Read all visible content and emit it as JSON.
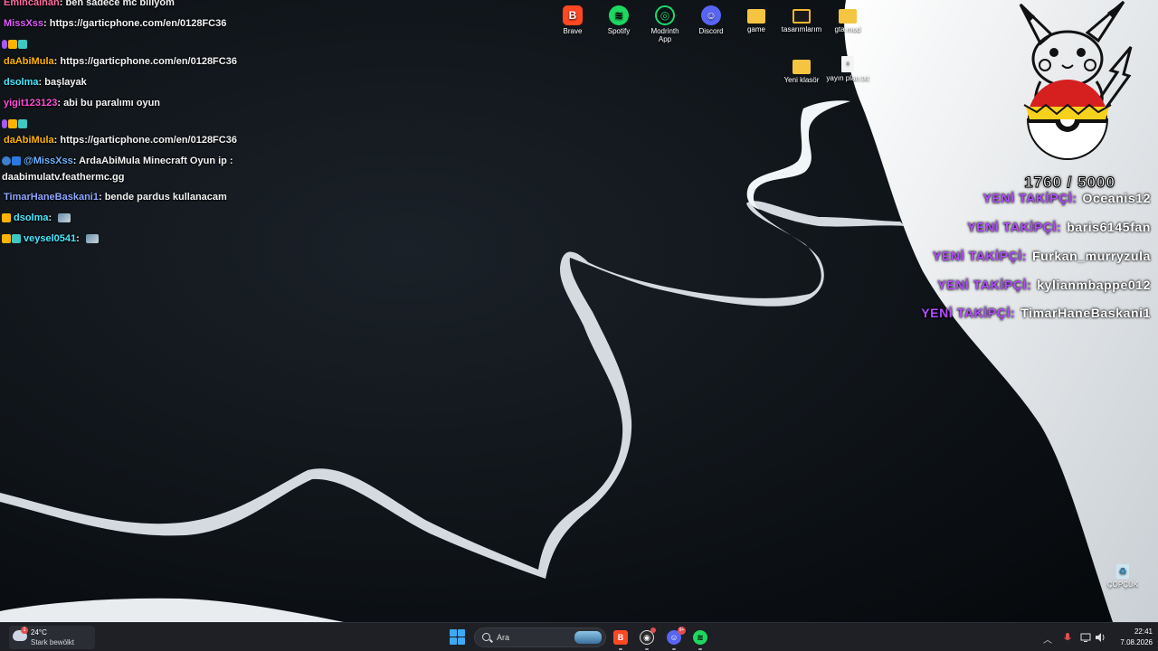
{
  "chat": {
    "messages": [
      {
        "user": "Emincalhan",
        "sep": ": ",
        "text": "ben sadece mc biliyom",
        "color": "#ff6b9d",
        "badges": [],
        "emote": false
      },
      {
        "user": "MissXss",
        "sep": ": ",
        "text": "https://garticphone.com/en/0128FC36",
        "color": "#e05cff",
        "badges": [],
        "emote": false
      },
      {
        "user": "",
        "sep": "",
        "text": "",
        "color": "#ffffff",
        "badges": [
          "mic",
          "crown",
          "gift"
        ],
        "emote": false
      },
      {
        "user": "daAbiMula",
        "sep": ": ",
        "text": "https://garticphone.com/en/0128FC36",
        "color": "#ffb300",
        "badges": [],
        "emote": false
      },
      {
        "user": "dsolma",
        "sep": ": ",
        "text": "başlayak",
        "color": "#49e8ff",
        "badges": [],
        "emote": false
      },
      {
        "user": "yigit123123",
        "sep": ": ",
        "text": "abi bu paralımı oyun",
        "color": "#ff4fd8",
        "badges": [],
        "emote": false
      },
      {
        "user": "",
        "sep": "",
        "text": "",
        "color": "#ffffff",
        "badges": [
          "mic",
          "crown",
          "gift"
        ],
        "emote": false
      },
      {
        "user": "daAbiMula",
        "sep": ": ",
        "text": "https://garticphone.com/en/0128FC36",
        "color": "#ffb300",
        "badges": [],
        "emote": false
      },
      {
        "user": "@MissXss",
        "sep": ": ",
        "text": "ArdaAbiMula Minecraft Oyun ip :",
        "color": "#6fb3ff",
        "badges": [
          "bot",
          "mod"
        ],
        "emote": false
      },
      {
        "user": "",
        "sep": "",
        "text": "daabimulatv.feathermc.gg",
        "color": "#ffffff",
        "badges": [],
        "emote": false
      },
      {
        "user": "TimarHaneBaskani1",
        "sep": ": ",
        "text": "bende pardus kullanacam",
        "color": "#8fa6ff",
        "badges": [],
        "emote": false
      },
      {
        "user": "dsolma",
        "sep": ": ",
        "text": "",
        "color": "#49e8ff",
        "badges": [
          "crown"
        ],
        "emote": true
      },
      {
        "user": "veysel0541",
        "sep": ": ",
        "text": "",
        "color": "#49e8ff",
        "badges": [
          "crown",
          "gift"
        ],
        "emote": true
      }
    ]
  },
  "desktop_icons": [
    {
      "label": "Brave",
      "icon": "brave-icon",
      "glyph": "B"
    },
    {
      "label": "Spotify",
      "icon": "spotify-icon",
      "glyph": "≋"
    },
    {
      "label": "Modrinth App",
      "icon": "modrinth-icon",
      "glyph": "◎"
    },
    {
      "label": "Discord",
      "icon": "discord-icon",
      "glyph": "☺"
    },
    {
      "label": "game",
      "icon": "folder-icon",
      "glyph": ""
    },
    {
      "label": "tasarımlarım",
      "icon": "folder-icon",
      "glyph": ""
    },
    {
      "label": "gta mod",
      "icon": "folder-icon",
      "glyph": ""
    },
    {
      "label": "Yeni klasör",
      "icon": "folder-icon",
      "glyph": ""
    },
    {
      "label": "yayın plan.txt",
      "icon": "text-file-icon",
      "glyph": "≡"
    },
    {
      "label": "ÇÖPÇÜK",
      "icon": "recycle-bin-icon",
      "glyph": "♻"
    }
  ],
  "goal": {
    "current": 1760,
    "target": 5000,
    "text": "1760 / 5000",
    "progress": 0.352
  },
  "follow_alerts": {
    "label": "YENİ TAKİPÇİ:",
    "names": [
      "Oceanis12",
      "baris6145fan",
      "Furkan_murryzula",
      "kylianmbappe012",
      "TimarHaneBaskani1"
    ]
  },
  "taskbar": {
    "weather": {
      "temp": "24°C",
      "desc": "Stark bewölkt",
      "badge": "1"
    },
    "search_placeholder": "Ara",
    "apps": [
      {
        "name": "brave",
        "glyph": "B",
        "color": "#ff4724"
      },
      {
        "name": "obs",
        "glyph": "◉",
        "color": "#2b2b2b"
      },
      {
        "name": "discord",
        "glyph": "☺",
        "color": "#5865f2"
      },
      {
        "name": "spotify",
        "glyph": "≋",
        "color": "#1ed760"
      }
    ],
    "discord_badge": "9+",
    "time": "22:41",
    "date": "7.08.2026"
  },
  "colors": {
    "follow_label": "#b24cff",
    "taskbar_bg": "#1e2025",
    "start_blue": "#3fa9f5"
  }
}
